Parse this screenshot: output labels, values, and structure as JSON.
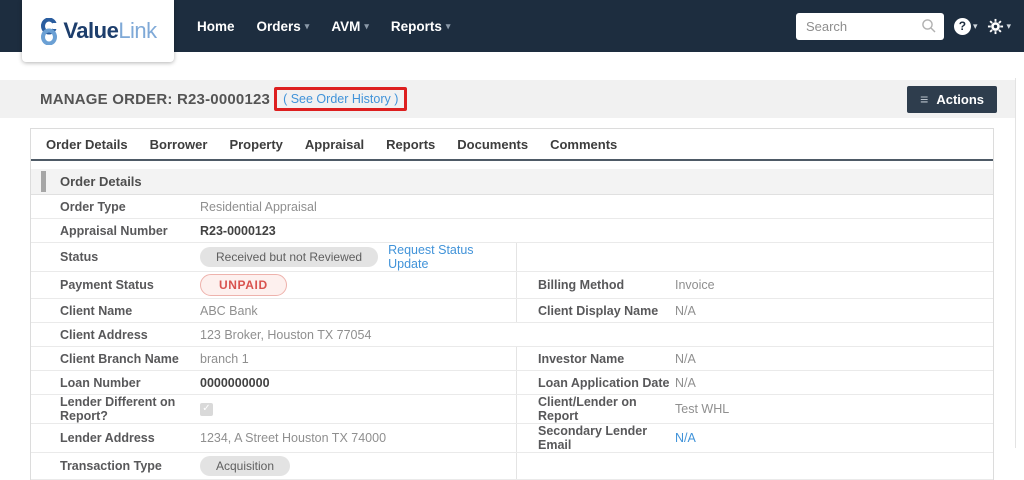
{
  "brand": {
    "name_part1": "Value",
    "name_part2": "Link",
    "icon": "chain-link-icon"
  },
  "nav": {
    "items": [
      {
        "label": "Home",
        "dropdown": false
      },
      {
        "label": "Orders",
        "dropdown": true
      },
      {
        "label": "AVM",
        "dropdown": true
      },
      {
        "label": "Reports",
        "dropdown": true
      }
    ]
  },
  "search": {
    "placeholder": "Search",
    "icon": "search-icon"
  },
  "header_icons": {
    "help": "help-icon",
    "settings": "gear-icon"
  },
  "page": {
    "title": "MANAGE ORDER: R23-0000123",
    "history_link": "( See Order History )",
    "actions_label": "Actions"
  },
  "tabs": [
    "Order Details",
    "Borrower",
    "Property",
    "Appraisal",
    "Reports",
    "Documents",
    "Comments"
  ],
  "section": {
    "title": "Order Details"
  },
  "details": {
    "order_type": {
      "label": "Order Type",
      "value": "Residential Appraisal"
    },
    "appraisal_number": {
      "label": "Appraisal Number",
      "value": "R23-0000123"
    },
    "status": {
      "label": "Status",
      "badge": "Received but not Reviewed",
      "link": "Request Status Update"
    },
    "payment_status": {
      "label": "Payment Status",
      "badge": "UNPAID"
    },
    "billing_method": {
      "label": "Billing Method",
      "value": "Invoice"
    },
    "client_name": {
      "label": "Client Name",
      "value": "ABC Bank"
    },
    "client_display_name": {
      "label": "Client Display Name",
      "value": "N/A"
    },
    "client_address": {
      "label": "Client Address",
      "value": "123 Broker, Houston TX 77054"
    },
    "client_branch_name": {
      "label": "Client Branch Name",
      "value": "branch 1"
    },
    "investor_name": {
      "label": "Investor Name",
      "value": "N/A"
    },
    "loan_number": {
      "label": "Loan Number",
      "value": "0000000000"
    },
    "loan_application_date": {
      "label": "Loan Application Date",
      "value": "N/A"
    },
    "lender_different": {
      "label": "Lender Different on Report?",
      "checked": true
    },
    "client_lender_on_report": {
      "label": "Client/Lender on Report",
      "value": "Test WHL"
    },
    "lender_address": {
      "label": "Lender Address",
      "value": "1234, A Street Houston TX 74000"
    },
    "secondary_lender_email": {
      "label": "Secondary Lender Email",
      "value": "N/A"
    },
    "transaction_type": {
      "label": "Transaction Type",
      "badge": "Acquisition"
    }
  },
  "colors": {
    "navbar_bg": "#1d2d3f",
    "brand_dark_blue": "#1d3e6c",
    "brand_light_blue": "#7fa9d7",
    "link_blue": "#4193d9",
    "unpaid_red": "#d9534f",
    "highlight_box_red": "#dd1f1f",
    "badge_gray_bg": "#e3e3e3",
    "header_bar_bg": "#f1f1f1"
  }
}
